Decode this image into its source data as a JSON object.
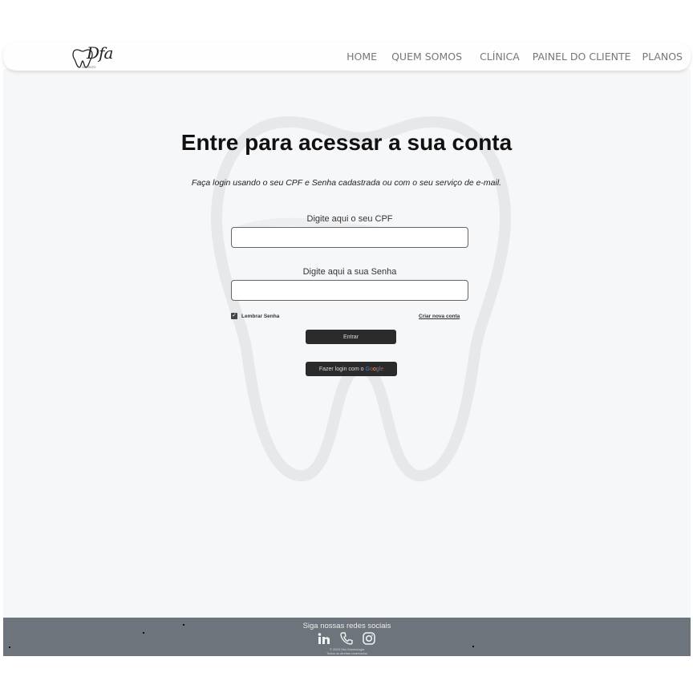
{
  "brand": {
    "logo_text": "Dfa",
    "logo_subtitle": "ODONTO"
  },
  "nav": {
    "items": [
      {
        "label": "HOME"
      },
      {
        "label": "QUEM SOMOS"
      },
      {
        "label": "CLÍNICA"
      },
      {
        "label": "PAINEL DO CLIENTE"
      },
      {
        "label": "PLANOS"
      }
    ]
  },
  "login": {
    "title": "Entre para acessar a sua conta",
    "subtitle": "Faça login usando o seu CPF e Senha cadastrada ou com o seu serviço de e-mail.",
    "cpf_label": "Digite aqui o seu CPF",
    "cpf_value": "",
    "senha_label": "Digite aqui a sua Senha",
    "senha_value": "",
    "remember_label": "Lembrar Senha",
    "remember_checked": true,
    "create_account": "Criar nova conta",
    "enter_button": "Entrar",
    "google_button_prefix": "Fazer login com o",
    "google_word": [
      "G",
      "o",
      "o",
      "g",
      "l",
      "e"
    ]
  },
  "footer": {
    "title": "Siga nossas redes sociais",
    "social_icons": [
      "linkedin-icon",
      "phone-icon",
      "instagram-icon"
    ],
    "copyright_line1": "© 2023 Dfa Odontologia",
    "copyright_line2": "Todos os direitos reservados"
  },
  "colors": {
    "footer_bg": "#6e747b",
    "button_bg": "#2b2b2b",
    "page_bg": "#f6f7f9"
  }
}
